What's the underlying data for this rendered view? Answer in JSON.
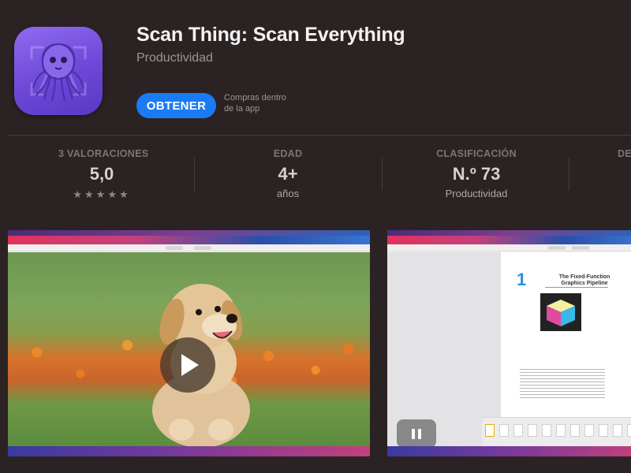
{
  "app": {
    "title": "Scan Thing: Scan Everything",
    "category": "Productividad",
    "get_label": "OBTENER",
    "iap_note": "Compras dentro de la app",
    "icon": "octopus-icon",
    "accent": "#1a7cf5"
  },
  "stats": [
    {
      "label": "3 VALORACIONES",
      "value": "5,0",
      "sub": "★★★★★"
    },
    {
      "label": "EDAD",
      "value": "4+",
      "sub": "años"
    },
    {
      "label": "CLASIFICACIÓN",
      "value": "N.º 73",
      "sub": "Productividad"
    },
    {
      "label": "DE"
    }
  ],
  "screenshots": [
    {
      "kind": "video",
      "control": "play-icon"
    },
    {
      "kind": "document",
      "control": "pause-icon",
      "doc_number": "1",
      "doc_title": "The Fixed-Function Graphics Pipeline"
    }
  ]
}
